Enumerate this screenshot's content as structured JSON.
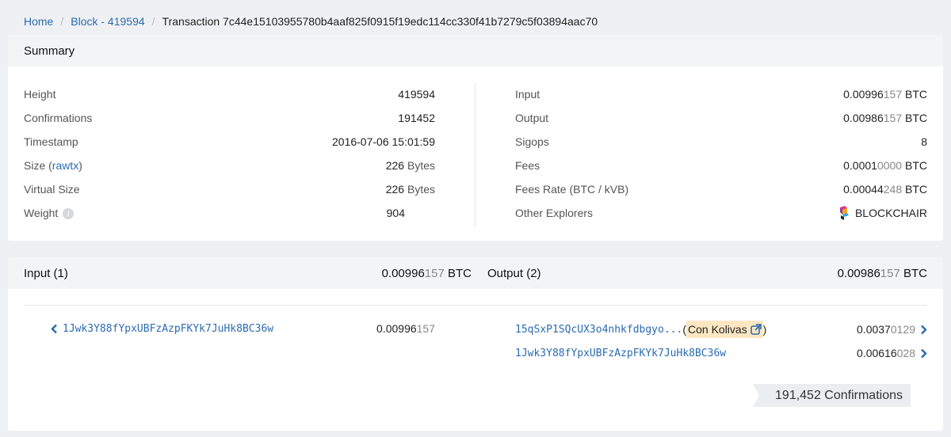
{
  "breadcrumb": {
    "home": "Home",
    "block": "Block - 419594",
    "current": "Transaction 7c44e15103955780b4aaf825f0915f19edc114cc330f41b7279c5f03894aac70"
  },
  "summary": {
    "title": "Summary",
    "left": {
      "height_label": "Height",
      "height_value": "419594",
      "confirmations_label": "Confirmations",
      "confirmations_value": "191452",
      "timestamp_label": "Timestamp",
      "timestamp_value": "2016-07-06 15:01:59",
      "size_label_pre": "Size (",
      "size_link": "rawtx",
      "size_label_post": ")",
      "size_value": "226",
      "size_unit": "Bytes",
      "vsize_label": "Virtual Size",
      "vsize_value": "226",
      "vsize_unit": "Bytes",
      "weight_label": "Weight",
      "weight_info_icon": "i",
      "weight_value": "904"
    },
    "right": {
      "input_label": "Input",
      "input_main": "0.00996",
      "input_dim": "157",
      "input_unit": "BTC",
      "output_label": "Output",
      "output_main": "0.00986",
      "output_dim": "157",
      "output_unit": "BTC",
      "sigops_label": "Sigops",
      "sigops_value": "8",
      "fees_label": "Fees",
      "fees_main": "0.0001",
      "fees_dim": "0000",
      "fees_unit": "BTC",
      "feerate_label": "Fees Rate (BTC / kVB)",
      "feerate_main": "0.00044",
      "feerate_dim": "248",
      "feerate_unit": "BTC",
      "explorers_label": "Other Explorers",
      "explorer_name": "BLOCKCHAIR"
    }
  },
  "tx": {
    "input_title": "Input (1)",
    "input_total_main": "0.00996",
    "input_total_dim": "157",
    "input_total_unit": "BTC",
    "output_title": "Output (2)",
    "output_total_main": "0.00986",
    "output_total_dim": "157",
    "output_total_unit": "BTC",
    "inputs": [
      {
        "address": "1Jwk3Y88fYpxUBFzAzpFKYk7JuHk8BC36w",
        "main": "0.00996",
        "dim": "157"
      }
    ],
    "outputs": [
      {
        "address": "15qSxP1SQcUX3o4nhkfdbgyo...",
        "tag": "Con Kolivas",
        "paren_open": "(",
        "paren_close": ")",
        "main": "0.0037",
        "dim": "0129"
      },
      {
        "address": "1Jwk3Y88fYpxUBFzAzpFKYk7JuHk8BC36w",
        "main": "0.00616",
        "dim": "028"
      }
    ],
    "confirmations_badge": "191,452 Confirmations"
  },
  "colors": {
    "link": "#2a6cb0",
    "tag_bg": "#fde7c2",
    "header_bg": "#f3f4f6"
  },
  "icons": {
    "back": "chevron-left-icon",
    "forward": "chevron-right-icon",
    "external": "external-link-icon",
    "explorer": "blockchair-logo-icon"
  }
}
